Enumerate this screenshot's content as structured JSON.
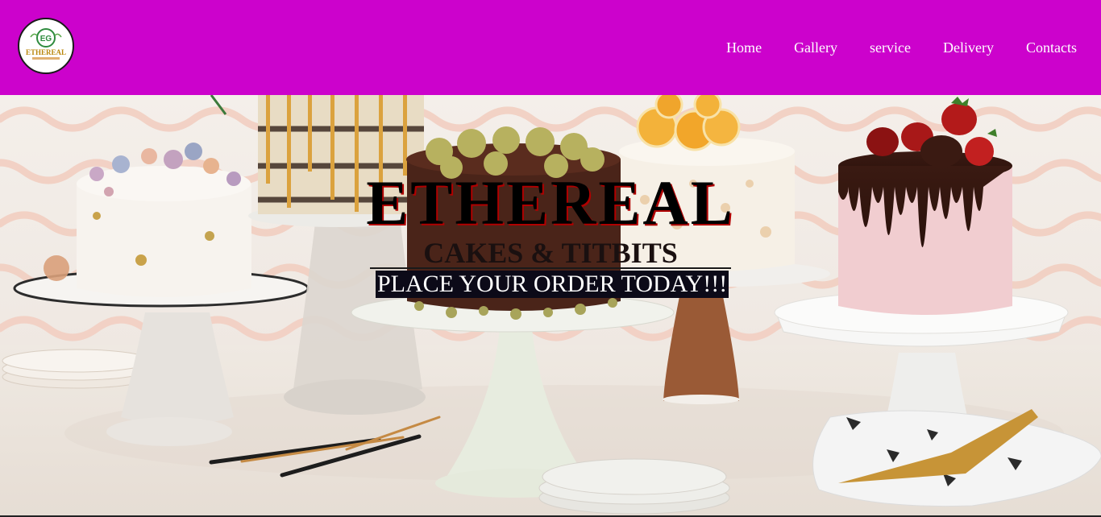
{
  "brand": {
    "logo_monogram": "EG",
    "logo_wordmark": "ETHEREAL"
  },
  "nav": {
    "items": [
      {
        "label": "Home"
      },
      {
        "label": "Gallery"
      },
      {
        "label": "service"
      },
      {
        "label": "Delivery"
      },
      {
        "label": "Contacts"
      }
    ]
  },
  "hero": {
    "title": "ETHEREAL",
    "subtitle": "CAKES & TITBITS",
    "cta": "PLACE YOUR ORDER TODAY!!!"
  },
  "colors": {
    "header_bg": "#cc02cc",
    "cta_bg": "#0c0a18"
  }
}
